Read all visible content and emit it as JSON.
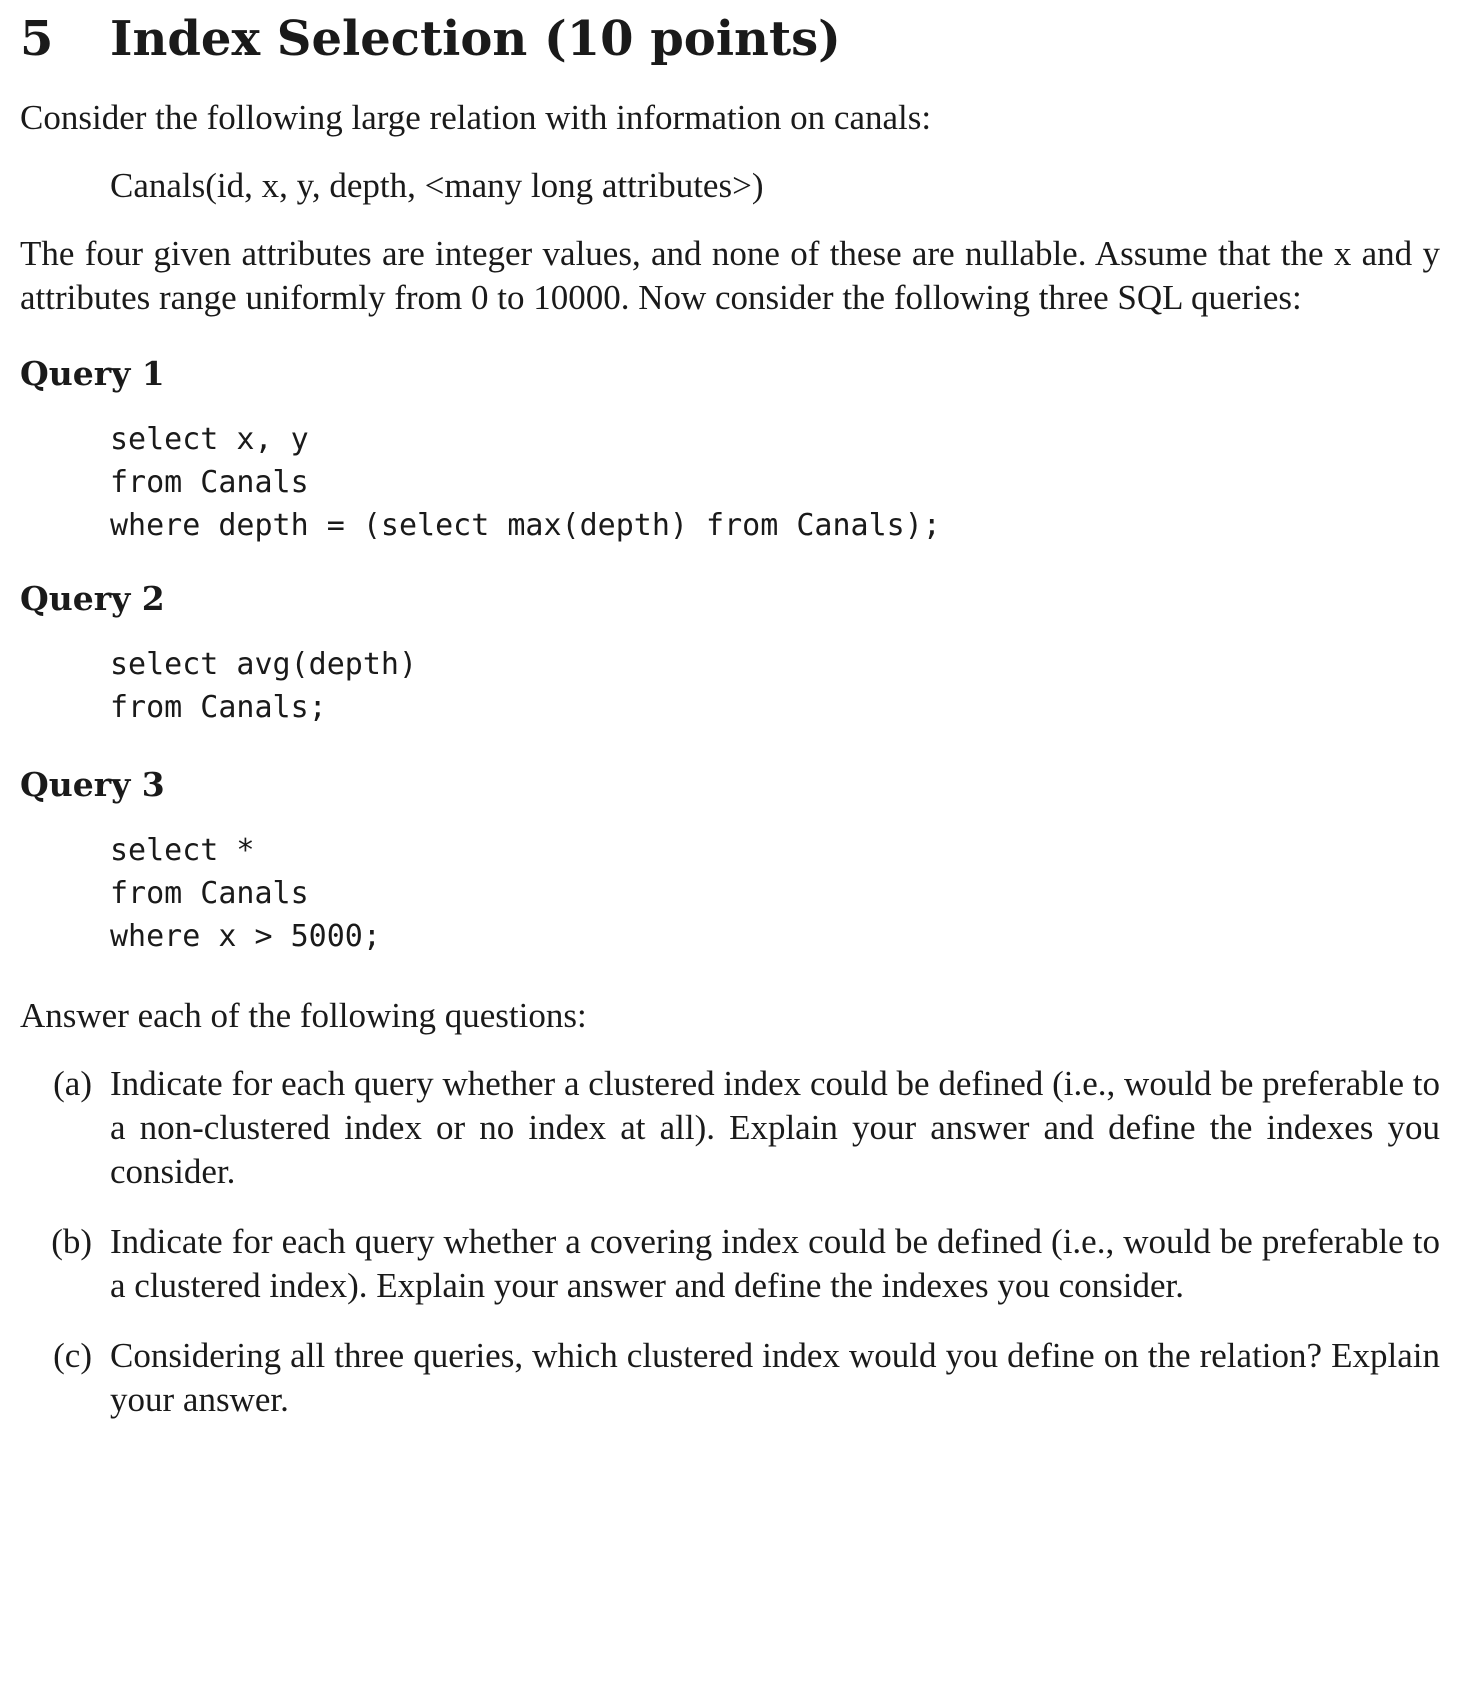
{
  "section": {
    "number": "5",
    "title": "Index Selection (10 points)"
  },
  "intro": "Consider the following large relation with information on canals:",
  "relation": "Canals(id, x, y, depth, <many long attributes>)",
  "description": "The four given attributes are integer values, and none of these are nullable. Assume that the x and y attributes range uniformly from 0 to 10000. Now consider the following three SQL queries:",
  "queries": [
    {
      "heading": "Query 1",
      "lines": [
        "select x, y",
        "from Canals",
        "where depth = (select max(depth) from Canals);"
      ]
    },
    {
      "heading": "Query 2",
      "lines": [
        "select avg(depth)",
        "from Canals;"
      ]
    },
    {
      "heading": "Query 3",
      "lines": [
        "select *",
        "from Canals",
        "where x > 5000;"
      ]
    }
  ],
  "answer_intro": "Answer each of the following questions:",
  "questions": [
    {
      "label": "(a)",
      "text": "Indicate for each query whether a clustered index could be defined (i.e., would be preferable to a non-clustered index or no index at all). Explain your answer and define the indexes you consider."
    },
    {
      "label": "(b)",
      "text": "Indicate for each query whether a covering index could be defined (i.e., would be preferable to a clustered index). Explain your answer and define the indexes you consider."
    },
    {
      "label": "(c)",
      "text": "Considering all three queries, which clustered index would you define on the relation? Explain your answer."
    }
  ]
}
